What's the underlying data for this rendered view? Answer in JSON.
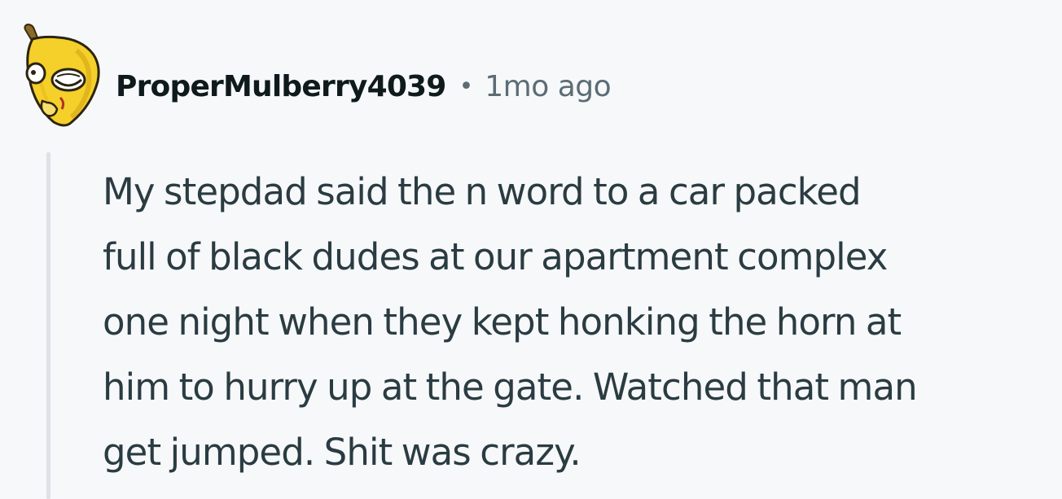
{
  "comment": {
    "author": "ProperMulberry4039",
    "separator": "•",
    "timestamp": "1mo ago",
    "avatar_icon": "banana-snoo-avatar-icon",
    "body_lines": [
      "My stepdad said the n word to a car packed",
      "full of black dudes at our apartment complex",
      "one night when they kept honking the horn at",
      "him to hurry up at the gate. Watched that man",
      "get jumped. Shit was crazy."
    ]
  },
  "colors": {
    "background": "#f7f8fa",
    "username": "#0f1a1c",
    "meta": "#5c6c74",
    "body_text": "#2a3c42",
    "thread_line": "#dde2e6",
    "avatar_yellow": "#f5cf2a"
  }
}
